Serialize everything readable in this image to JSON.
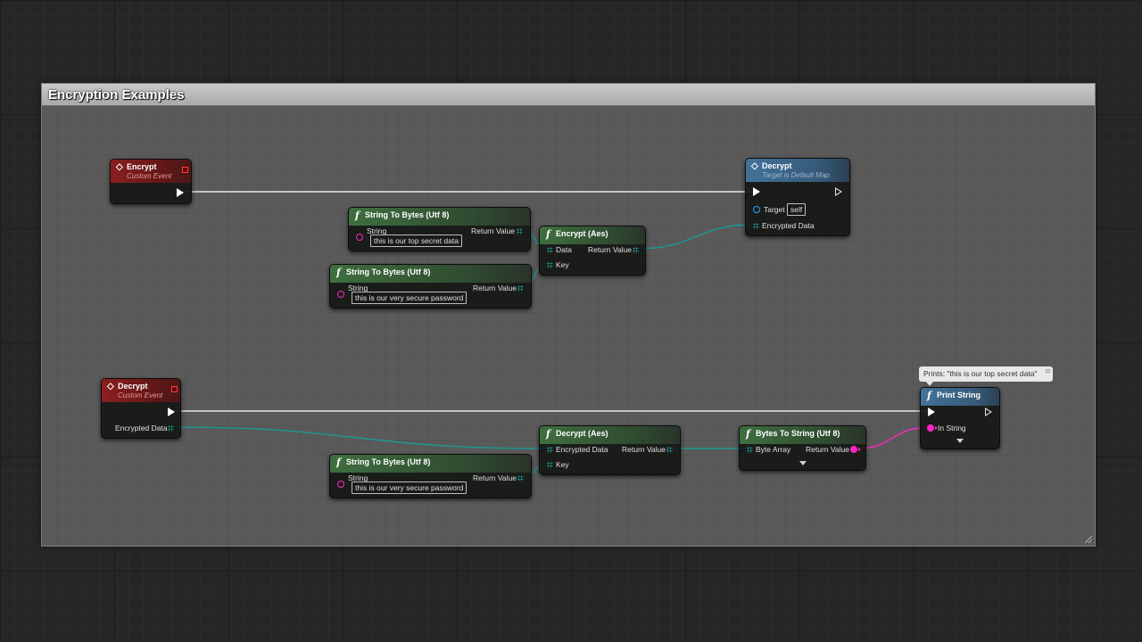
{
  "comment": {
    "title": "Encryption Examples"
  },
  "nodes": {
    "encrypt_event": {
      "title": "Encrypt",
      "subtitle": "Custom Event"
    },
    "decrypt_call": {
      "title": "Decrypt",
      "subtitle": "Target is Default Map",
      "target_label": "Target",
      "target_value": "self",
      "encrypted_data_label": "Encrypted Data"
    },
    "string_to_bytes_1": {
      "title": "String To Bytes (Utf 8)",
      "string_label": "String",
      "string_value": "this is our top secret data",
      "return_label": "Return Value"
    },
    "string_to_bytes_2": {
      "title": "String To Bytes (Utf 8)",
      "string_label": "String",
      "string_value": "this is our very secure password",
      "return_label": "Return Value"
    },
    "encrypt_aes": {
      "title": "Encrypt (Aes)",
      "data_label": "Data",
      "key_label": "Key",
      "return_label": "Return Value"
    },
    "decrypt_event": {
      "title": "Decrypt",
      "subtitle": "Custom Event",
      "encrypted_data_label": "Encrypted Data"
    },
    "string_to_bytes_3": {
      "title": "String To Bytes (Utf 8)",
      "string_label": "String",
      "string_value": "this is our very secure password",
      "return_label": "Return Value"
    },
    "decrypt_aes": {
      "title": "Decrypt (Aes)",
      "encrypted_data_label": "Encrypted Data",
      "key_label": "Key",
      "return_label": "Return Value"
    },
    "bytes_to_string": {
      "title": "Bytes To String (Utf 8)",
      "byte_array_label": "Byte Array",
      "return_label": "Return Value"
    },
    "print_string": {
      "title": "Print String",
      "in_string_label": "In String",
      "bubble": "Prints: \"this is our top secret data\""
    }
  },
  "colors": {
    "exec_wire": "#e8e8e8",
    "array_wire": "#1a9a96",
    "string_wire": "#ff27c5",
    "event_header": "#8c1f20",
    "function_header": "#3f6f3f",
    "member_header": "#42729a"
  },
  "icons": {
    "event": "diamond-event-icon",
    "function": "function-f-icon"
  }
}
